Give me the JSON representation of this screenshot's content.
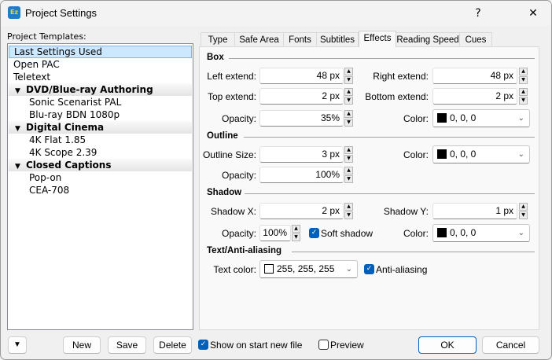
{
  "window": {
    "title": "Project Settings",
    "icon_text": "Ez",
    "help": "?",
    "close": "✕"
  },
  "templates": {
    "label": "Project Templates:",
    "items": [
      {
        "label": "Last Settings Used",
        "type": "item",
        "selected": true
      },
      {
        "label": "Open PAC",
        "type": "item"
      },
      {
        "label": "Teletext",
        "type": "item"
      },
      {
        "label": "DVD/Blue-ray Authoring",
        "type": "group"
      },
      {
        "label": "Sonic Scenarist PAL",
        "type": "sub"
      },
      {
        "label": "Blu-ray BDN 1080p",
        "type": "sub"
      },
      {
        "label": "Digital Cinema",
        "type": "group"
      },
      {
        "label": "4K Flat 1.85",
        "type": "sub"
      },
      {
        "label": "4K Scope 2.39",
        "type": "sub"
      },
      {
        "label": "Closed Captions",
        "type": "group"
      },
      {
        "label": "Pop-on",
        "type": "sub"
      },
      {
        "label": "CEA-708",
        "type": "sub"
      }
    ]
  },
  "tabs": [
    {
      "label": "Type"
    },
    {
      "label": "Safe Area"
    },
    {
      "label": "Fonts"
    },
    {
      "label": "Subtitles"
    },
    {
      "label": "Effects",
      "active": true
    },
    {
      "label": "Reading Speed"
    },
    {
      "label": "Cues"
    }
  ],
  "box": {
    "title": "Box",
    "left_label": "Left extend:",
    "left": "48 px",
    "right_label": "Right extend:",
    "right": "48 px",
    "top_label": "Top extend:",
    "top": "2 px",
    "bottom_label": "Bottom extend:",
    "bottom": "2 px",
    "opacity_label": "Opacity:",
    "opacity": "35%",
    "color_label": "Color:",
    "color": "0, 0, 0",
    "color_hex": "#000000"
  },
  "outline": {
    "title": "Outline",
    "size_label": "Outline Size:",
    "size": "3 px",
    "color_label": "Color:",
    "color": "0, 0, 0",
    "color_hex": "#000000",
    "opacity_label": "Opacity:",
    "opacity": "100%"
  },
  "shadow": {
    "title": "Shadow",
    "x_label": "Shadow X:",
    "x": "2 px",
    "y_label": "Shadow Y:",
    "y": "1 px",
    "opacity_label": "Opacity:",
    "opacity": "100%",
    "soft_label": "Soft shadow",
    "soft": true,
    "color_label": "Color:",
    "color": "0, 0, 0",
    "color_hex": "#000000"
  },
  "text": {
    "title": "Text/Anti-aliasing",
    "color_label": "Text color:",
    "color": "255, 255, 255",
    "color_hex": "#ffffff",
    "aa_label": "Anti-aliasing",
    "aa": true
  },
  "footer": {
    "menu_glyph": "▼",
    "new": "New",
    "save": "Save",
    "delete": "Delete",
    "show_label": "Show on start new file",
    "show": true,
    "preview_label": "Preview",
    "preview": false,
    "ok": "OK",
    "cancel": "Cancel"
  },
  "colors": {
    "accent": "#005fb8",
    "selection": "#cce8ff"
  }
}
